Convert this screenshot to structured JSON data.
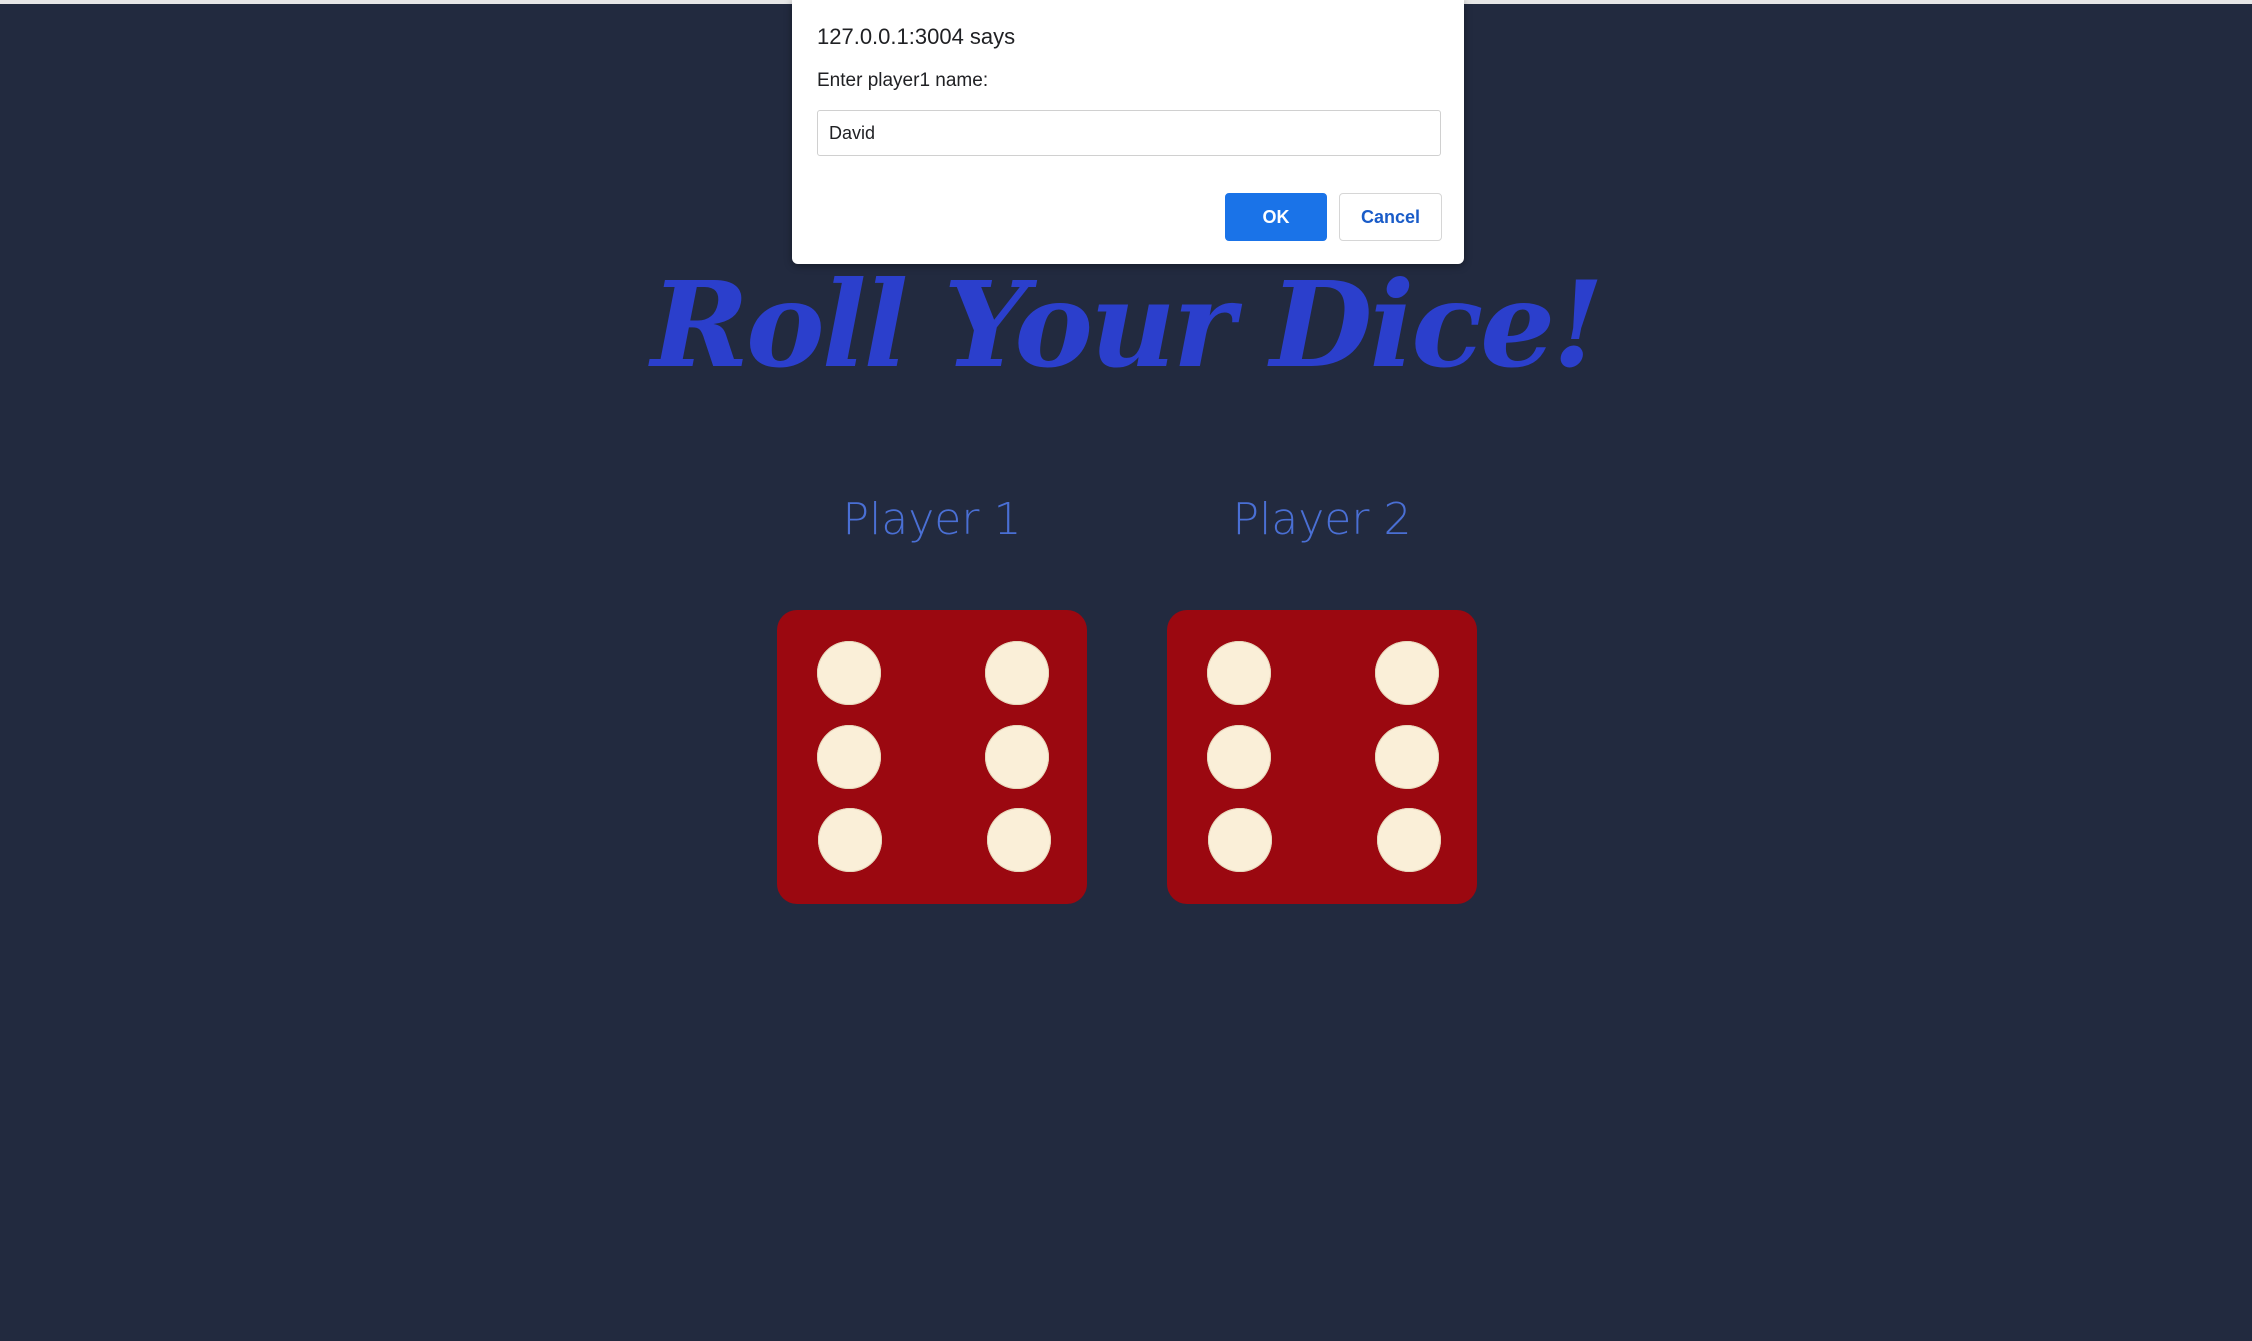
{
  "dialog": {
    "title": "127.0.0.1:3004 says",
    "message": "Enter player1 name:",
    "input_value": "David",
    "ok_label": "OK",
    "cancel_label": "Cancel"
  },
  "page": {
    "title": "Roll Your Dice!",
    "players": [
      {
        "label": "Player 1",
        "die_value": 6
      },
      {
        "label": "Player 2",
        "die_value": 6
      }
    ]
  },
  "colors": {
    "background": "#222a3f",
    "title": "#2b3fcc",
    "player_label": "#4a6fd4",
    "die": "#9b0810",
    "pip": "#faefd8",
    "ok_button": "#1a73e8"
  }
}
